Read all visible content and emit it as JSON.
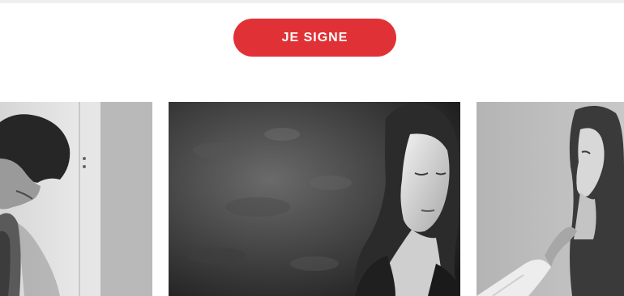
{
  "cta": {
    "label": "JE SIGNE",
    "color": "#e03236"
  },
  "gallery": {
    "photos": [
      {
        "icon": "photo-boy-looking-down"
      },
      {
        "icon": "photo-girl-eyes-closed-against-wall"
      },
      {
        "icon": "photo-girl-profile-hand-on-shoulder"
      }
    ]
  }
}
